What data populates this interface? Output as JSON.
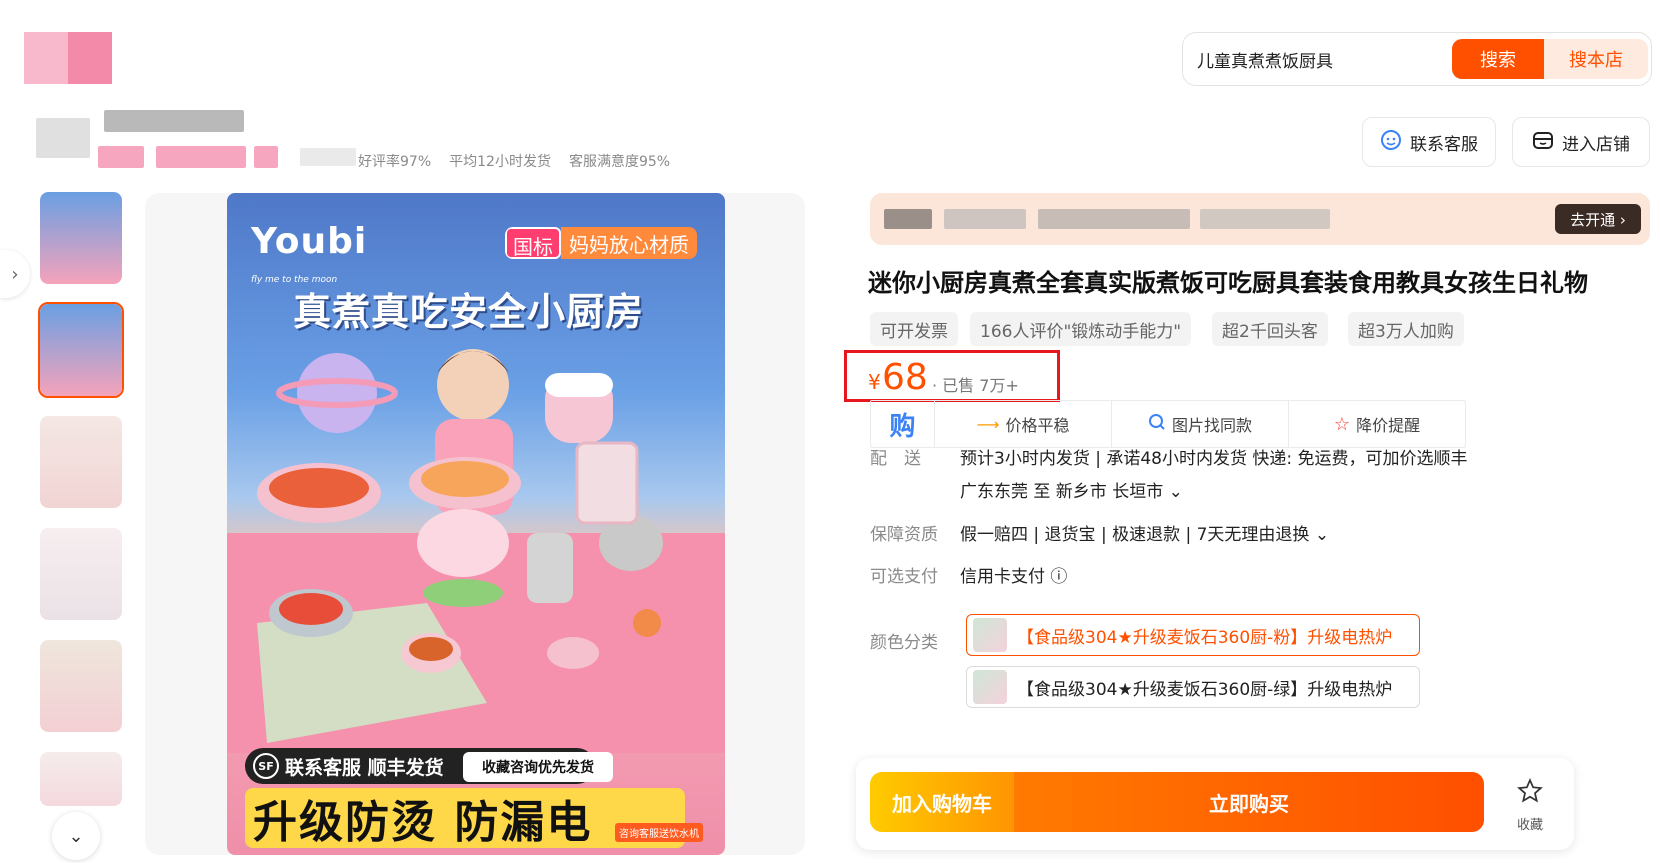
{
  "header": {
    "search_query": "儿童真煮煮饭厨具",
    "search_button": "搜索",
    "search_store_button": "搜本店",
    "camera_icon": "camera-icon"
  },
  "shop": {
    "stats": [
      "好评率97%",
      "平均12小时发货",
      "客服满意度95%"
    ],
    "contact_button": "联系客服",
    "enter_store_button": "进入店铺"
  },
  "gallery": {
    "main_image": {
      "brand": "Youbi",
      "tagline": "fly me to the moon",
      "badge_left": "国标",
      "badge_right": "妈妈放心材质",
      "headline": "真煮真吃安全小厨房",
      "promo_contact": "联系客服 顺丰发货",
      "promo_sf": "SF",
      "promo_favorite": "收藏咨询优先发货",
      "promo_main": "升级防烫 防漏电",
      "promo_small": "咨询客服送饮水机"
    },
    "thumbnail_count": 6,
    "selected_thumbnail": 2
  },
  "product": {
    "banner_button": "去开通 ›",
    "title": "迷你小厨房真煮全套真实版煮饭可吃厨具套装食用教具女孩生日礼物",
    "tags": [
      "可开发票",
      "166人评价\"锻炼动手能力\"",
      "超2千回头客",
      "超3万人加购"
    ],
    "price_symbol": "¥",
    "price": "68",
    "sold": "· 已售 7万+",
    "features": {
      "gou": "购",
      "f1": "价格平稳",
      "f2": "图片找同款",
      "f3": "降价提醒"
    },
    "shipping_label": "配　送",
    "shipping_line1": "预计3小时内发货 | 承诺48小时内发货  快递: 免运费，可加价选顺丰",
    "shipping_line2": "广东东莞  至  新乡市 长垣市 ⌄",
    "guarantee_label": "保障资质",
    "guarantee_value": "假一赔四  |  退货宝  |  极速退款  |  7天无理由退换 ⌄",
    "payment_label": "可选支付",
    "payment_value": "信用卡支付 ⓘ",
    "color_label": "颜色分类",
    "color_options": [
      "【食品级304★升级麦饭石360厨-粉】升级电热炉",
      "【食品级304★升级麦饭石360厨-绿】升级电热炉"
    ],
    "add_to_cart": "加入购物车",
    "buy_now": "立即购买",
    "favorite": "收藏"
  },
  "colors": {
    "accent": "#ff5000",
    "highlight_box": "#e8161f"
  }
}
